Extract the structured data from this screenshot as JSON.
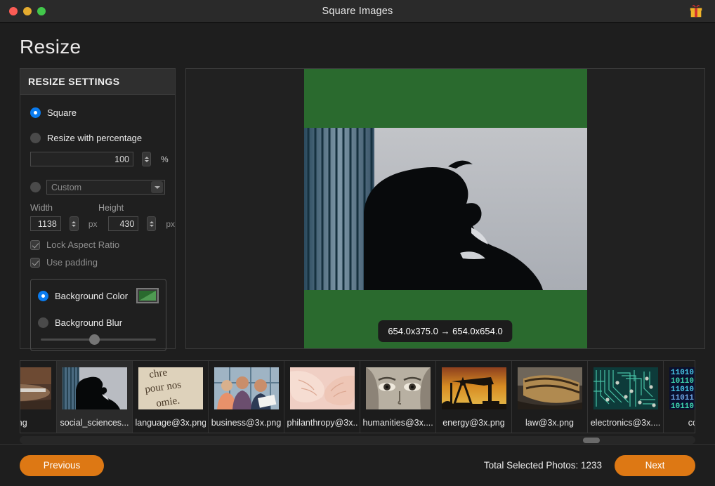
{
  "window": {
    "title": "Square Images",
    "traffic_lights": [
      "close",
      "minimize",
      "zoom"
    ],
    "gift_icon": "gift-icon"
  },
  "page": {
    "title": "Resize"
  },
  "settings": {
    "header": "RESIZE SETTINGS",
    "square": {
      "label": "Square",
      "selected": true
    },
    "percentage": {
      "label": "Resize with percentage",
      "selected": false,
      "value": "100",
      "unit": "%"
    },
    "custom": {
      "label": "Custom",
      "selected": false,
      "placeholder": "Custom"
    },
    "width": {
      "label": "Width",
      "value": "1138",
      "unit": "px"
    },
    "height": {
      "label": "Height",
      "value": "430",
      "unit": "px"
    },
    "lock_aspect_ratio": {
      "label": "Lock Aspect Ratio",
      "checked": true
    },
    "use_padding": {
      "label": "Use padding",
      "checked": true
    },
    "background_color": {
      "label": "Background Color",
      "selected": true,
      "color": "#2a6a2e"
    },
    "background_blur": {
      "label": "Background Blur",
      "selected": false,
      "slider_value": 45
    }
  },
  "preview": {
    "dimension_badge": "654.0x375.0 → 654.0x654.0",
    "padding_color": "#2a6a2e"
  },
  "thumbnails": [
    {
      "name": "...ng",
      "selected": false,
      "kind": "pottery"
    },
    {
      "name": "social_sciences...",
      "selected": true,
      "kind": "silhouette"
    },
    {
      "name": "language@3x.png",
      "selected": false,
      "kind": "text-paper"
    },
    {
      "name": "business@3x.png",
      "selected": false,
      "kind": "meeting"
    },
    {
      "name": "philanthropy@3x...",
      "selected": false,
      "kind": "hands"
    },
    {
      "name": "humanities@3x....",
      "selected": false,
      "kind": "portrait-eyes"
    },
    {
      "name": "energy@3x.png",
      "selected": false,
      "kind": "oil-pump"
    },
    {
      "name": "law@3x.png",
      "selected": false,
      "kind": "gavel-wood"
    },
    {
      "name": "electronics@3x....",
      "selected": false,
      "kind": "circuit-board"
    },
    {
      "name": "compu",
      "selected": false,
      "kind": "binary-code"
    }
  ],
  "footer": {
    "previous_label": "Previous",
    "next_label": "Next",
    "total_label": "Total Selected Photos: 1233",
    "accent_color": "#dd7814"
  }
}
